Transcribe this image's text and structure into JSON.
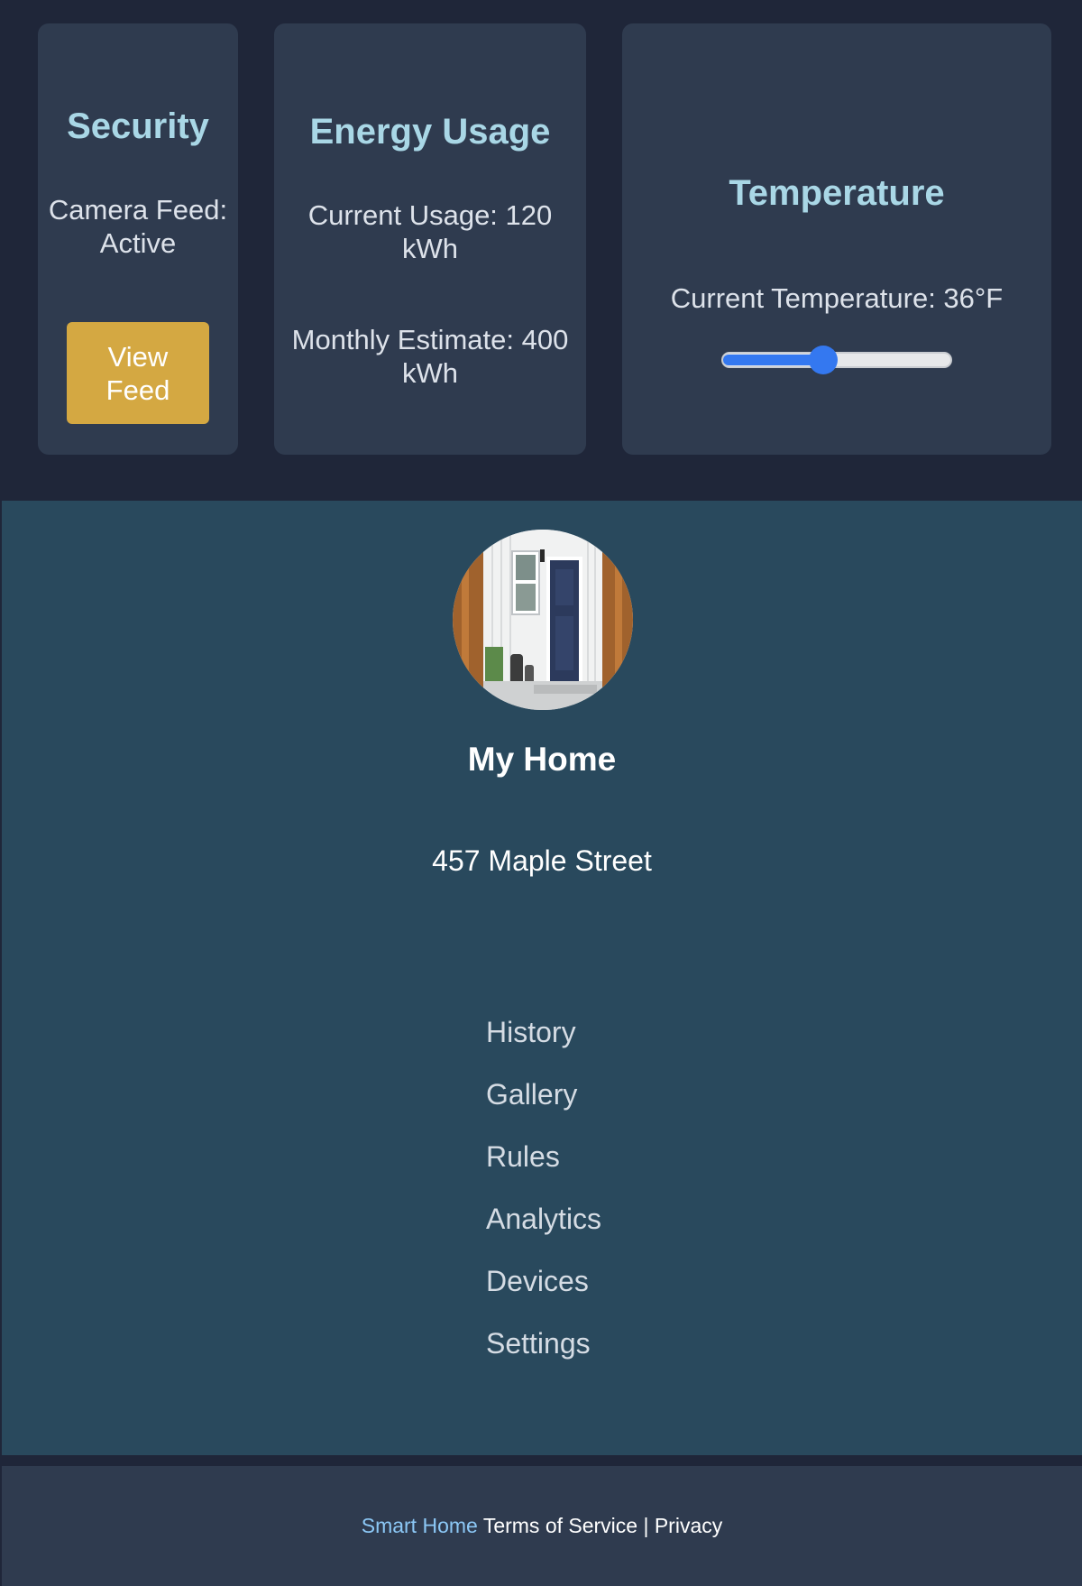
{
  "security": {
    "title": "Security",
    "camera_status": "Camera Feed: Active",
    "view_button": "View Feed"
  },
  "energy": {
    "title": "Energy Usage",
    "current": "Current Usage: 120 kWh",
    "monthly": "Monthly Estimate: 400 kWh"
  },
  "temperature": {
    "title": "Temperature",
    "current": "Current Temperature: 36°F",
    "slider_fraction": 0.44
  },
  "profile": {
    "title": "My Home",
    "address": "457 Maple Street"
  },
  "nav": {
    "items": [
      "History",
      "Gallery",
      "Rules",
      "Analytics",
      "Devices",
      "Settings"
    ]
  },
  "footer": {
    "brand": "Smart Home",
    "terms": "Terms of Service",
    "separator": "|",
    "privacy": "Privacy"
  },
  "colors": {
    "accent_button": "#d4a842",
    "heading": "#a9d7e6",
    "slider": "#3478f0",
    "profile_bg": "#29495d",
    "card_bg": "#2f3b4f"
  },
  "icons": {
    "avatar": "house-front-door-photo"
  }
}
